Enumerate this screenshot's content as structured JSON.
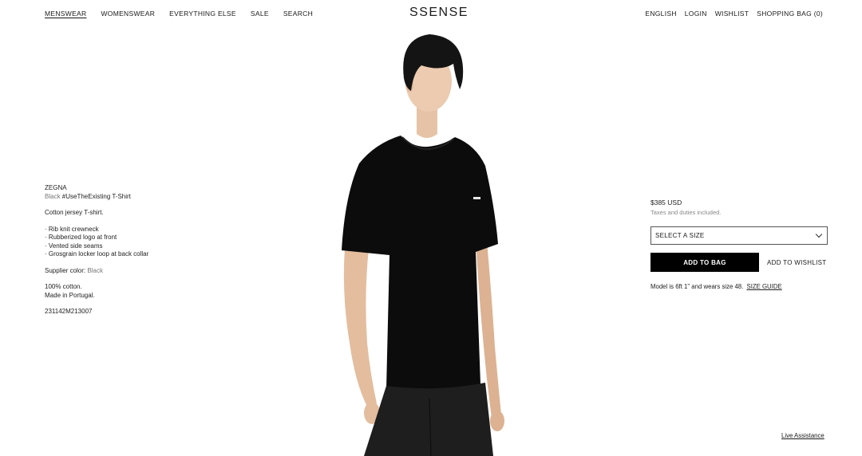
{
  "header": {
    "nav_left": [
      "MENSWEAR",
      "WOMENSWEAR",
      "EVERYTHING ELSE",
      "SALE",
      "SEARCH"
    ],
    "logo": "SSENSE",
    "nav_right": [
      "ENGLISH",
      "LOGIN",
      "WISHLIST",
      "SHOPPING BAG (0)"
    ]
  },
  "product": {
    "brand": "ZEGNA",
    "color_prefix": "Black",
    "name": "#UseTheExisting T-Shirt",
    "description": "Cotton jersey T-shirt.",
    "features": [
      "· Rib knit crewneck",
      "· Rubberized logo at front",
      "· Vented side seams",
      "· Grosgrain locker loop at back collar"
    ],
    "supplier_color_label": "Supplier color:",
    "supplier_color_value": "Black",
    "composition": "100% cotton.",
    "origin": "Made in Portugal.",
    "sku": "231142M213007"
  },
  "purchase": {
    "price": "$385 USD",
    "taxes": "Taxes and duties included.",
    "size_placeholder": "SELECT A SIZE",
    "add_to_bag": "ADD TO BAG",
    "add_to_wishlist": "ADD TO WISHLIST",
    "model_info": "Model is 6ft 1\" and wears size 48.",
    "size_guide": "SIZE GUIDE"
  },
  "footer": {
    "live_assistance": "Live Assistance"
  },
  "colors": {
    "button_bg": "#000000",
    "text": "#1a1a1a",
    "muted": "#777777"
  }
}
